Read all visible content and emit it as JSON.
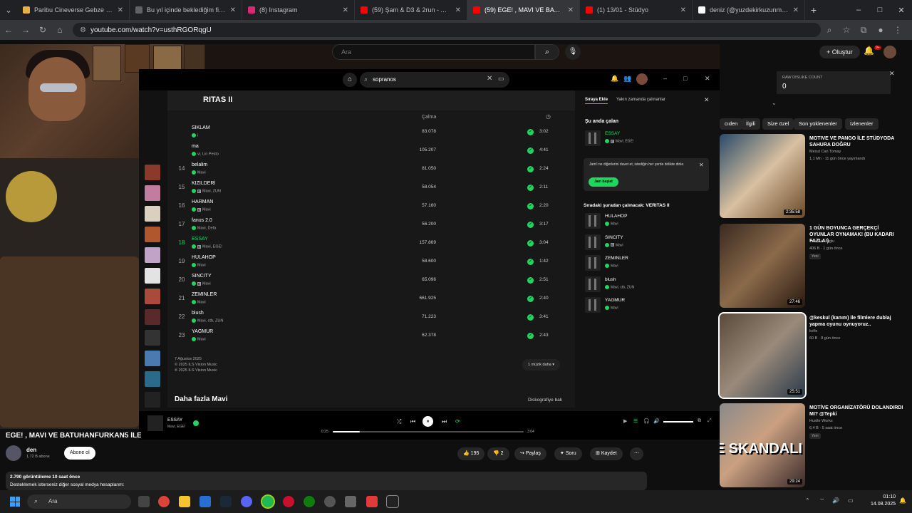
{
  "browser": {
    "tabs": [
      {
        "title": "Paribu Cineverse Gebze Center",
        "color": "#e8b04a",
        "active": false
      },
      {
        "title": "Bu yıl içinde beklediğim filmler",
        "color": "#5f6368",
        "active": false
      },
      {
        "title": "(8) Instagram",
        "color": "#d62976",
        "active": false
      },
      {
        "title": "(59) Şam & D3 & 2run - Anti-D",
        "color": "#ff0000",
        "active": false
      },
      {
        "title": "(59) EGE! , MAVI VE BATUHAN",
        "color": "#ff0000",
        "active": true
      },
      {
        "title": "(1) 13/01 - Stüdyo",
        "color": "#ff0000",
        "active": false
      },
      {
        "title": "deniz (@yuzdekirkuzunmetro)",
        "color": "#ffffff",
        "active": false
      }
    ],
    "new_tab": "+",
    "url": "youtube.com/watch?v=usthRGORqgU"
  },
  "youtube": {
    "search_placeholder": "Ara",
    "create_label": "Oluştur",
    "notif_count": "9+",
    "stats_label": "RAW DISLIKE COUNT",
    "stats_value": "0",
    "chips": [
      "cıden",
      "İlgili",
      "Size özel",
      "Son yüklenenler",
      "İzlenenler"
    ],
    "recs": [
      {
        "title": "MOTIVE VE PANGO İLE STÜDYODA SAHURA DOĞRU",
        "channel": "Mesut Can Tomay",
        "meta": "1,1 Mn · 11 gün önce yayınlandı",
        "duration": "2:35:58",
        "badge": ""
      },
      {
        "title": "1 GÜN BOYUNCA GERÇEKÇİ OYUNLAR OYNAMAK! (BU KADARI FAZLA!)",
        "channel": "Enis Kirazoglu",
        "meta": "406 B · 1 gün önce",
        "duration": "27:46",
        "badge": "Yeni"
      },
      {
        "title": "@keskul (kanım) ile filmlere dublaj yapma oyunu oynuyoruz..",
        "channel": "kefix",
        "meta": "60 B · 8 gün önce",
        "duration": "25:51",
        "badge": ""
      },
      {
        "title": "MOTİVE ORGANİZATÖRÜ DOLANDIRDI MI? @Tepki",
        "channel": "Hustle Works",
        "meta": "6,4 B · 5 saat önce",
        "duration": "29:24",
        "badge": "Yeni",
        "overlay": "TURNE SKANDALI"
      }
    ],
    "video_title": "EGE! , MAVI VE BATUHANFURKAN5 İLE",
    "channel_name": "den",
    "channel_subs": "1,72 B abone",
    "subscribe_label": "Abone ol",
    "likes": "195",
    "dislikes": "2",
    "share_label": "Paylaş",
    "ask_label": "Soru",
    "save_label": "Kaydet",
    "desc_stats": "2.790 görüntüleme  10 saat önce",
    "desc_text": "Desteklemek isterseniz diğer sosyal medya hesaplarım:"
  },
  "spotify": {
    "search_value": "sopranos",
    "album_title": "RITAS II",
    "col_plays": "Çalma",
    "tracks": [
      {
        "num": "",
        "name": "SIKLAM",
        "artists": "i",
        "plays": "83.078",
        "dur": "3:02",
        "explicit": false
      },
      {
        "num": "",
        "name": "ma",
        "artists": "vi, Lin Pesto",
        "plays": "105.207",
        "dur": "4:41",
        "explicit": false
      },
      {
        "num": "14",
        "name": "belalim",
        "artists": "Mavi",
        "plays": "81.050",
        "dur": "2:24",
        "explicit": false
      },
      {
        "num": "15",
        "name": "KIZILDERİ",
        "artists": "Mavi, ZUN",
        "plays": "58.054",
        "dur": "2:11",
        "explicit": true
      },
      {
        "num": "16",
        "name": "HARMAN",
        "artists": "Mavi",
        "plays": "57.160",
        "dur": "2:20",
        "explicit": true
      },
      {
        "num": "17",
        "name": "fanus 2.0",
        "artists": "Mavi, Defa",
        "plays": "56.200",
        "dur": "3:17",
        "explicit": false
      },
      {
        "num": "18",
        "name": "ESSAY",
        "artists": "Mavi, EGE!",
        "plays": "157.869",
        "dur": "3:04",
        "explicit": true,
        "playing": true
      },
      {
        "num": "19",
        "name": "HULAHOP",
        "artists": "Mavi",
        "plays": "58.600",
        "dur": "1:42",
        "explicit": false
      },
      {
        "num": "20",
        "name": "SINCITY",
        "artists": "Mavi",
        "plays": "65.096",
        "dur": "2:51",
        "explicit": true
      },
      {
        "num": "21",
        "name": "ZEMINLER",
        "artists": "Mavi",
        "plays": "661.925",
        "dur": "2:40",
        "explicit": false
      },
      {
        "num": "22",
        "name": "blush",
        "artists": "Mavi, ctb, ZUN",
        "plays": "71.223",
        "dur": "3:41",
        "explicit": false
      },
      {
        "num": "23",
        "name": "YAGMUR",
        "artists": "Mavi",
        "plays": "62.378",
        "dur": "2:43",
        "explicit": false
      }
    ],
    "release_date": "7 Ağustos 2025",
    "copyright1": "© 2025 ILS Vision Music",
    "copyright2": "℗ 2025 ILS Vision Music",
    "more_songs": "1 müzik daha",
    "more_by": "Daha fazla Mavi",
    "discography": "Diskografiye bak",
    "queue_tab": "Sıraya Ekle",
    "recent_tab": "Yakın zamanda çalınanlar",
    "now_playing_label": "Şu anda çalan",
    "now_playing": {
      "name": "ESSAY",
      "artists": "Mavi, EGE!"
    },
    "jam_text": "Jam'i ne diğerlerini davet et, istediğin her yerde birlikte dinle.",
    "jam_button": "Jam başlat",
    "next_label": "Sıradaki şuradan çalınacak: VERITAS II",
    "queue": [
      {
        "name": "HULAHOP",
        "artists": "Mavi",
        "explicit": false
      },
      {
        "name": "SINCITY",
        "artists": "Mavi",
        "explicit": true
      },
      {
        "name": "ZEMINLER",
        "artists": "Mavi",
        "explicit": false
      },
      {
        "name": "blush",
        "artists": "Mavi, ctb, ZUN",
        "explicit": false
      },
      {
        "name": "YAGMUR",
        "artists": "Mavi",
        "explicit": false
      }
    ],
    "player": {
      "name": "ESSAY",
      "artists": "Mavi, EGE!",
      "elapsed": "0:25",
      "total": "3:04",
      "progress": 0.14
    }
  },
  "taskbar": {
    "search_placeholder": "Ara",
    "time": "01:10",
    "date": "14.08.2025"
  }
}
